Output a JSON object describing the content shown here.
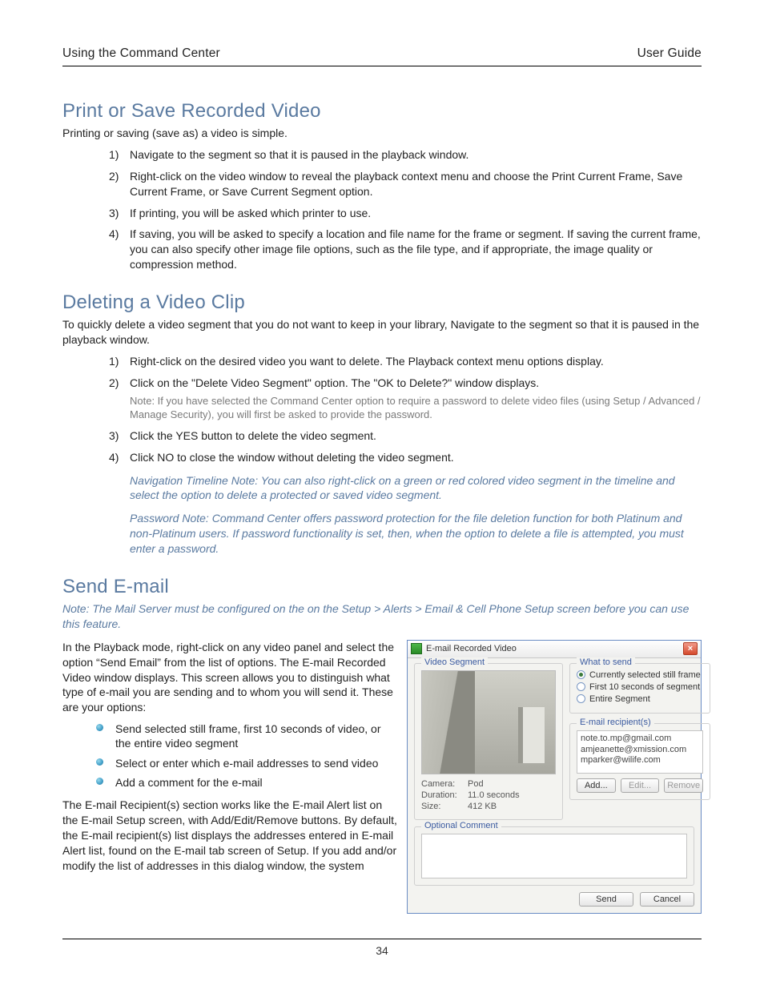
{
  "header": {
    "left": "Using the Command Center",
    "right": "User Guide"
  },
  "section1": {
    "title": "Print or Save Recorded Video",
    "intro": "Printing or saving (save as) a video is simple.",
    "steps": [
      "Navigate to the segment so that it is paused in the playback window.",
      "Right-click on the video window to reveal the playback context menu and choose the Print Current Frame, Save Current Frame, or Save Current Segment option.",
      "If printing, you will be asked which printer to use.",
      "If saving, you will be asked to specify a location and file name for the frame or segment. If saving the current frame, you can also specify other image file options, such as the file type, and if appropriate, the image quality or compression method."
    ]
  },
  "section2": {
    "title": "Deleting a Video Clip",
    "intro": "To quickly delete a video segment that you do not want to keep in your library, Navigate to the segment so that it is paused in the playback window.",
    "steps": [
      "Right-click on the desired video you want to delete. The Playback context menu options display.",
      "Click on the \"Delete Video Segment\" option.  The \"OK to Delete?\" window displays.",
      "Click the YES button to delete the video segment.",
      "Click NO to close the window without deleting the video segment."
    ],
    "note_after_step2": "Note:  If you have selected the Command Center option to require a password to delete video files (using Setup / Advanced / Manage Security), you will first be asked to provide the password.",
    "nav_note": "Navigation Timeline Note: You can also right-click on a green or red colored video segment in the timeline and select the option to delete a protected or saved video segment.",
    "pwd_note": "Password Note: Command Center offers password protection for the file deletion function for both Platinum and non-Platinum users. If password functionality is set, then, when the option to delete a file is attempted, you must enter a password."
  },
  "section3": {
    "title": "Send E-mail",
    "config_note": "Note:  The Mail Server must be configured on the on the Setup > Alerts >  Email & Cell Phone Setup screen before you can use this feature.",
    "para1": "In the Playback mode, right-click on any video panel and select the option “Send Email” from the list of options.   The E-mail Recorded Video window displays.  This screen allows you to distinguish what type of e-mail you are sending and to whom you will send it.  These are your options:",
    "bullets": [
      "Send selected still frame, first 10 seconds of video, or the entire video segment",
      "Select or enter which e-mail addresses to send video",
      "Add a comment for the e-mail"
    ],
    "para2": "The E-mail Recipient(s) section works like the E-mail Alert list on the E-mail Setup screen, with Add/Edit/Remove buttons.  By default, the E-mail recipient(s) list displays the addresses entered in E-mail Alert list, found on the E-mail tab screen of Setup.  If you add and/or modify the list of addresses in this dialog window, the system"
  },
  "dialog": {
    "title": "E-mail Recorded Video",
    "group_video": "Video Segment",
    "group_what": "What to send",
    "group_recip": "E-mail recipient(s)",
    "group_comment": "Optional Comment",
    "radios": {
      "opt1": "Currently selected still frame",
      "opt2": "First 10 seconds of segment",
      "opt3": "Entire Segment"
    },
    "meta": {
      "camera_lab": "Camera:",
      "camera_val": "Pod",
      "duration_lab": "Duration:",
      "duration_val": "11.0 seconds",
      "size_lab": "Size:",
      "size_val": "412 KB"
    },
    "recipients": {
      "r1": "note.to.mp@gmail.com",
      "r2": "amjeanette@xmission.com",
      "r3": "mparker@wilife.com"
    },
    "buttons": {
      "add": "Add...",
      "edit": "Edit...",
      "remove": "Remove",
      "send": "Send",
      "cancel": "Cancel"
    }
  },
  "page_number": "34"
}
